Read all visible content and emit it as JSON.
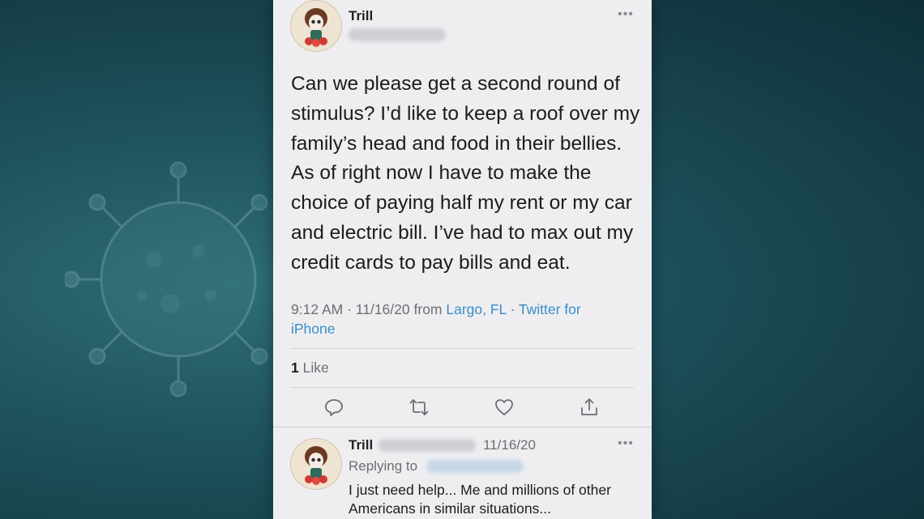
{
  "tweet": {
    "author_name": "Trill",
    "text": "Can we please get a second round of stimulus? I’d like to keep a roof over my family’s head and food in their bellies. As of right now I have to make the choice of paying half my rent or my car and electric bill. I’ve had to max out my credit cards to pay bills and eat.",
    "time": "9:12 AM",
    "date": "11/16/20",
    "from_label": "from",
    "location": "Largo, FL",
    "source_line1": "Twitter for",
    "source_line2": "iPhone",
    "like_count": "1",
    "like_label": "Like",
    "more_label": "•••"
  },
  "reply": {
    "author_name": "Trill",
    "date": "11/16/20",
    "replying_to_label": "Replying to",
    "text_line1": "I just need help... Me and millions of other",
    "text_line2": "Americans in similar situations...",
    "more_label": "•••"
  },
  "actions": [
    {
      "icon": "reply-icon"
    },
    {
      "icon": "retweet-icon"
    },
    {
      "icon": "like-heart-icon"
    },
    {
      "icon": "share-icon"
    }
  ],
  "colors": {
    "background": "#1f5560",
    "card": "#eeeef0",
    "link": "#3a8dc8",
    "text": "#1c1c1e",
    "muted": "#6e6e73"
  }
}
